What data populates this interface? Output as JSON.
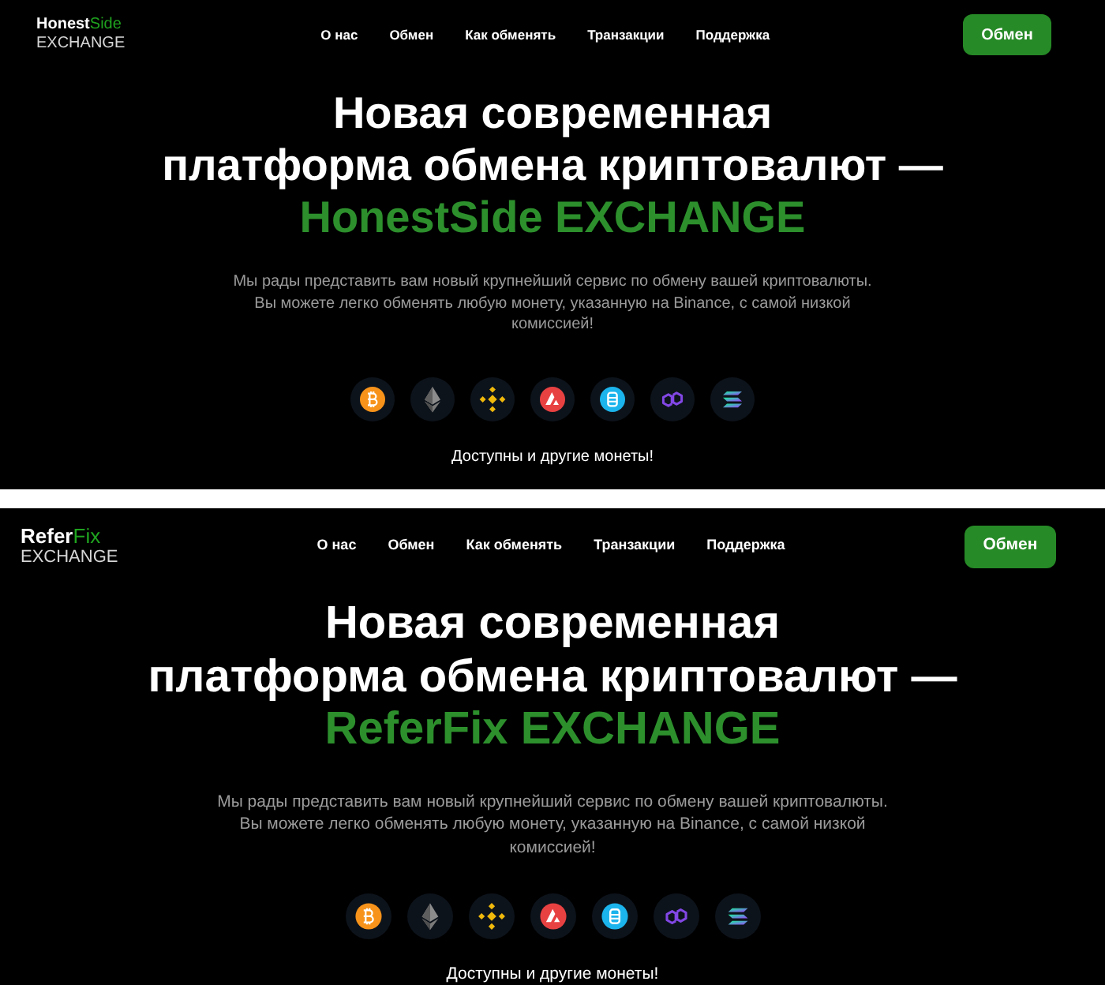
{
  "panels": [
    {
      "logo": {
        "name": "Honest",
        "accent": "Side",
        "subtitle": "EXCHANGE"
      },
      "nav": [
        "О нас",
        "Обмен",
        "Как обменять",
        "Транзакции",
        "Поддержка"
      ],
      "cta": "Обмен",
      "heading": {
        "lines": [
          "Новая современная",
          "платформа обмена криптовалют —"
        ],
        "accent": "HonestSide EXCHANGE"
      },
      "intro": [
        "Мы рады представить вам новый крупнейший сервис по обмену вашей криптовалюты.",
        "Вы можете легко обменять любую монету, указанную на Binance, с самой низкой комиссией!"
      ],
      "note": "Доступны и другие монеты!"
    },
    {
      "logo": {
        "name": "Refer",
        "accent": "Fix",
        "subtitle": "EXCHANGE"
      },
      "nav": [
        "О нас",
        "Обмен",
        "Как обменять",
        "Транзакции",
        "Поддержка"
      ],
      "cta": "Обмен",
      "heading": {
        "lines": [
          "Новая современная",
          "платформа обмена криптовалют —"
        ],
        "accent": "ReferFix EXCHANGE"
      },
      "intro": [
        "Мы рады представить вам новый крупнейший сервис по обмену вашей криптовалюты.",
        "Вы можете легко обменять любую монету, указанную на Binance, с самой низкой комиссией!"
      ],
      "note": "Доступны и другие монеты!"
    }
  ]
}
